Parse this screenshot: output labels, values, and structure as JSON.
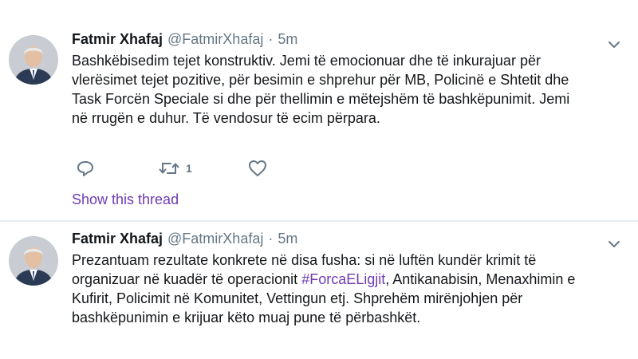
{
  "tweets": [
    {
      "name": "Fatmir Xhafaj",
      "handle": "@FatmirXhafaj",
      "separator": "·",
      "time": "5m",
      "lines": [
        "Bashkëbisedim tejet konstruktiv. Jemi të emocionuar dhe të inkurajuar për",
        "vlerësimet tejet pozitive, për besimin e shprehur për MB, Policinë e Shtetit dhe",
        "Task Forcën Speciale si dhe për thellimin e mëtejshëm të bashkëpunimit. Jemi",
        "në rrugën e duhur. Të vendosur të ecim përpara."
      ],
      "actions": {
        "reply_icon": "reply-icon",
        "retweet_icon": "retweet-icon",
        "retweet_count": "1",
        "like_icon": "heart-icon"
      },
      "show_thread": "Show this thread"
    },
    {
      "name": "Fatmir Xhafaj",
      "handle": "@FatmirXhafaj",
      "separator": "·",
      "time": "5m",
      "lines": {
        "l1": "Prezantuam rezultate konkrete në disa fusha: si në luftën kundër krimit të",
        "l2": "organizuar në kuadër të operacionit",
        "l2_hashtag": "#ForcaELigjit",
        "l2_rest": ", Antikanabisin, Menaxhimin e",
        "l3": "Kufirit, Policimit në Komunitet, Vettingun etj. Shprehëm mirënjohjen për",
        "l4": "bashkëpunimin e krijuar këto muaj pune të përbashkët."
      }
    }
  ],
  "colors": {
    "link": "#6e3bb3",
    "muted": "#657786",
    "text": "#14171a",
    "divider": "#e6ecf0"
  }
}
